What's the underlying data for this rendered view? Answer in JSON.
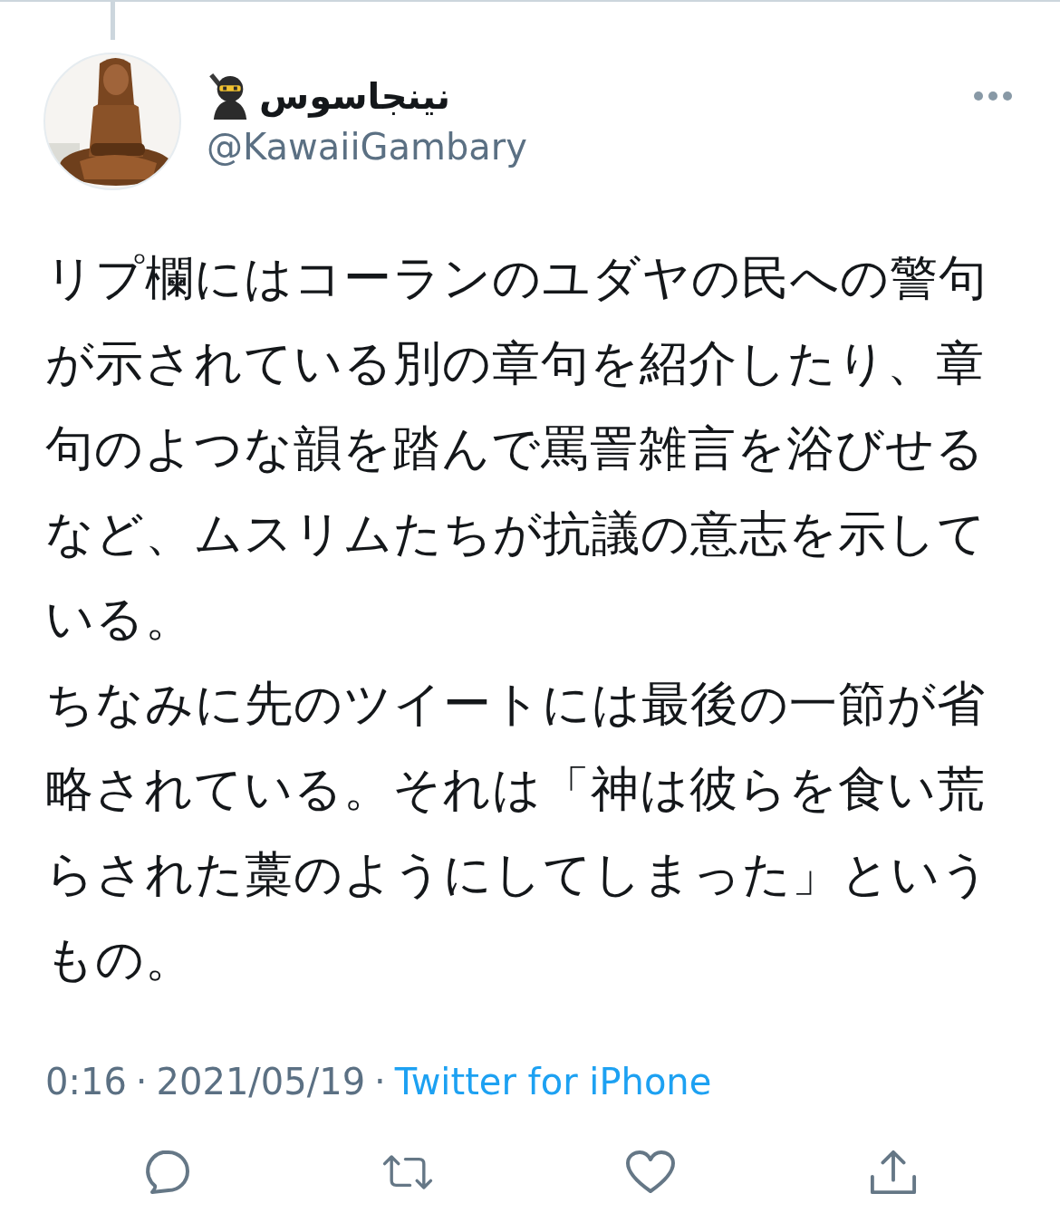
{
  "tweet": {
    "author": {
      "name": "نینجاسوس",
      "handle": "@KawaiiGambary"
    },
    "paragraphs": [
      "リプ欄にはコーランのユダヤの民への警句が示されている別の章句を紹介したり、章句のよつな韻を踏んで罵詈雑言を浴びせるなど、ムスリムたちが抗議の意志を示している。",
      "ちなみに先のツイートには最後の一節が省略されている。それは「神は彼らを食い荒らされた藁のようにしてしまった」というもの。"
    ],
    "time": "0:16",
    "separator_1": "·",
    "date": "2021/05/19",
    "separator_2": "·",
    "source": "Twitter for iPhone",
    "actions": [
      {
        "kind": "reply"
      },
      {
        "kind": "retweet"
      },
      {
        "kind": "like"
      },
      {
        "kind": "share"
      }
    ]
  }
}
